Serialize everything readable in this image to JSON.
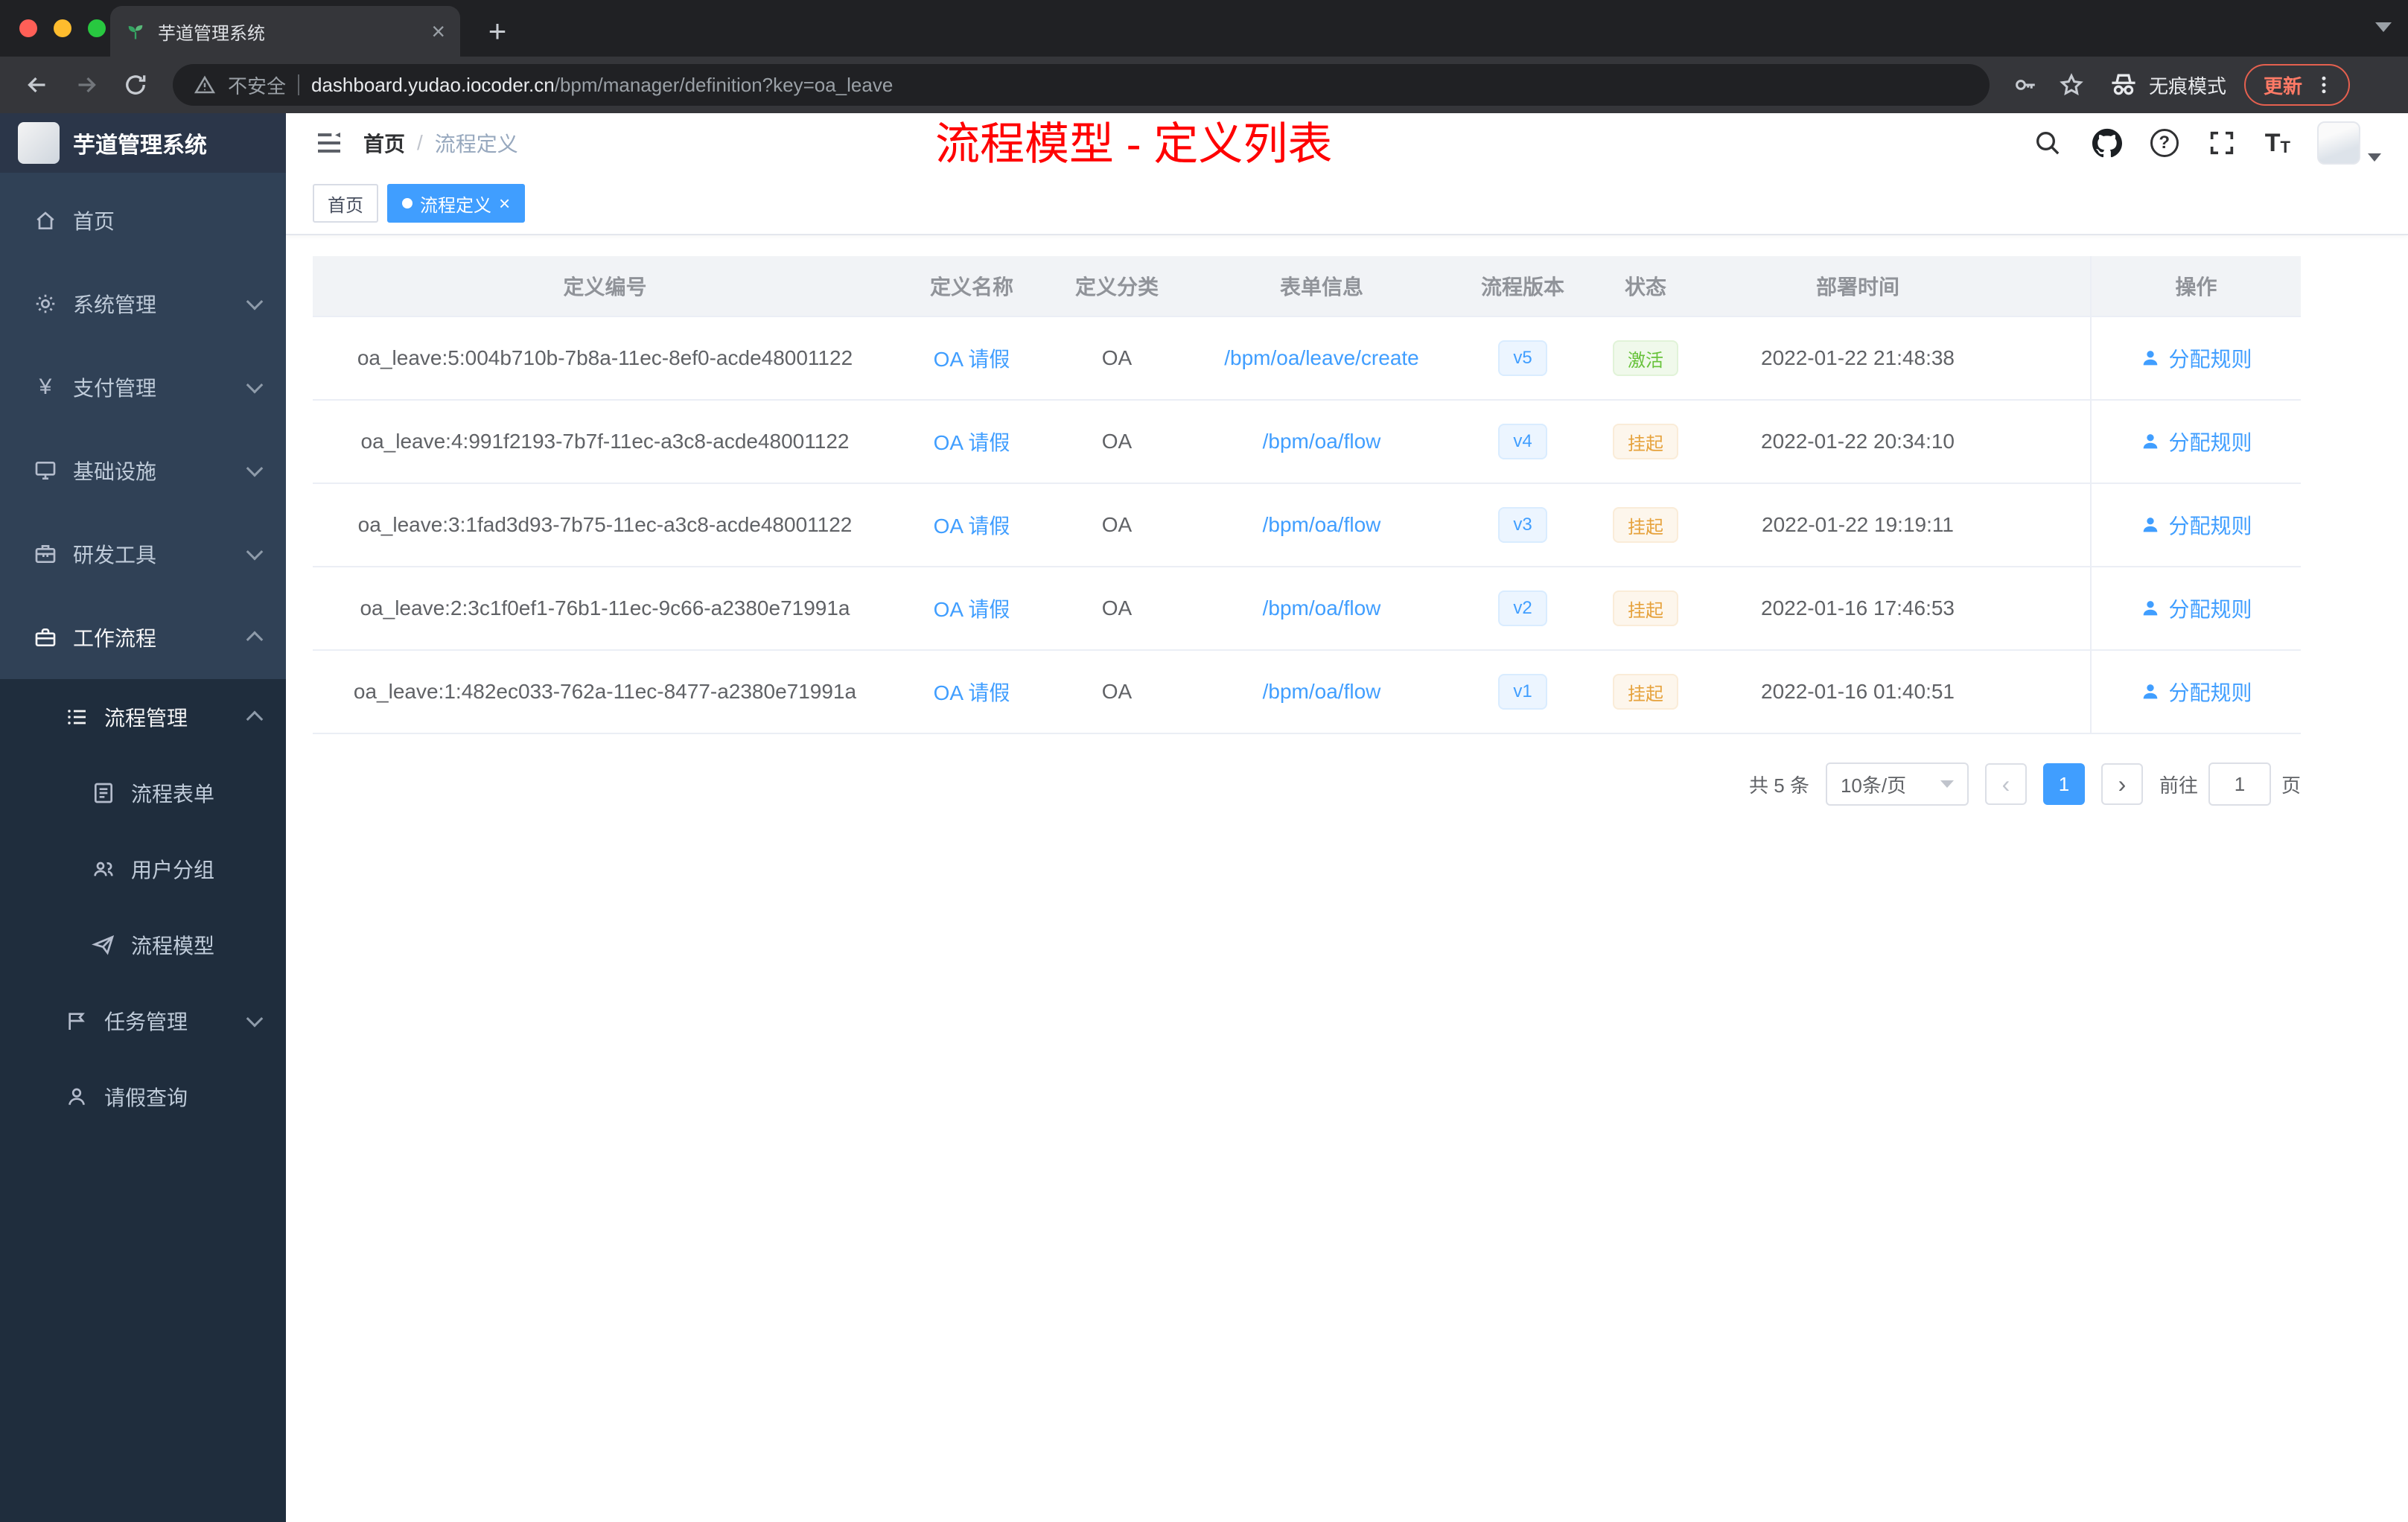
{
  "colors": {
    "accent": "#409eff",
    "success": "#67c23a",
    "warning": "#e6a23c",
    "annotation_red": "#ff0000",
    "sidebar_bg": "#304156",
    "submenu_bg": "#1f2d3d"
  },
  "glyphs": {
    "close": "×",
    "plus": "+",
    "yen": "¥",
    "question": "?",
    "font_big": "T",
    "font_small": "T"
  },
  "icons": {
    "tab_favicon": "plant-icon",
    "security": "warning-triangle-icon",
    "toolbar_right": [
      "key-icon",
      "star-icon",
      "incognito-icon"
    ],
    "header_right": [
      "search-icon",
      "github-icon",
      "question-icon",
      "fullscreen-icon",
      "font-size-icon"
    ]
  },
  "browser": {
    "tab_title": "芋道管理系统",
    "security_label": "不安全",
    "url_domain": "dashboard.yudao.iocoder.cn",
    "url_path": "/bpm/manager/definition?key=oa_leave",
    "incognito_label": "无痕模式",
    "update_label": "更新"
  },
  "sidebar": {
    "brand": "芋道管理系统",
    "items": [
      {
        "label": "首页",
        "icon": "home-icon"
      },
      {
        "label": "系统管理",
        "icon": "gear-icon",
        "chevron": "down"
      },
      {
        "label": "支付管理",
        "icon": "yen-icon",
        "chevron": "down"
      },
      {
        "label": "基础设施",
        "icon": "monitor-icon",
        "chevron": "down"
      },
      {
        "label": "研发工具",
        "icon": "toolbox-icon",
        "chevron": "down"
      },
      {
        "label": "工作流程",
        "icon": "briefcase-icon",
        "chevron": "up",
        "active": true
      },
      {
        "label": "流程管理",
        "icon": "list-icon",
        "chevron": "up",
        "level": 1
      },
      {
        "label": "流程表单",
        "icon": "form-icon",
        "level": 2
      },
      {
        "label": "用户分组",
        "icon": "users-icon",
        "level": 2
      },
      {
        "label": "流程模型",
        "icon": "send-icon",
        "level": 2
      },
      {
        "label": "任务管理",
        "icon": "flag-icon",
        "chevron": "down",
        "level": 1
      },
      {
        "label": "请假查询",
        "icon": "user-icon",
        "level": 1
      }
    ]
  },
  "header": {
    "breadcrumb_home": "首页",
    "breadcrumb_separator": "/",
    "breadcrumb_current": "流程定义",
    "annotation": "流程模型 - 定义列表"
  },
  "tags": [
    {
      "label": "首页",
      "active": false
    },
    {
      "label": "流程定义",
      "active": true
    }
  ],
  "table": {
    "columns": [
      "定义编号",
      "定义名称",
      "定义分类",
      "表单信息",
      "流程版本",
      "状态",
      "部署时间",
      "操作"
    ],
    "rows": [
      {
        "id": "oa_leave:5:004b710b-7b8a-11ec-8ef0-acde48001122",
        "name": "OA 请假",
        "category": "OA",
        "form": "/bpm/oa/leave/create",
        "version": "v5",
        "status": "激活",
        "status_type": "success",
        "time": "2022-01-22 21:48:38",
        "action": "分配规则"
      },
      {
        "id": "oa_leave:4:991f2193-7b7f-11ec-a3c8-acde48001122",
        "name": "OA 请假",
        "category": "OA",
        "form": "/bpm/oa/flow",
        "version": "v4",
        "status": "挂起",
        "status_type": "warning",
        "time": "2022-01-22 20:34:10",
        "action": "分配规则"
      },
      {
        "id": "oa_leave:3:1fad3d93-7b75-11ec-a3c8-acde48001122",
        "name": "OA 请假",
        "category": "OA",
        "form": "/bpm/oa/flow",
        "version": "v3",
        "status": "挂起",
        "status_type": "warning",
        "time": "2022-01-22 19:19:11",
        "action": "分配规则"
      },
      {
        "id": "oa_leave:2:3c1f0ef1-76b1-11ec-9c66-a2380e71991a",
        "name": "OA 请假",
        "category": "OA",
        "form": "/bpm/oa/flow",
        "version": "v2",
        "status": "挂起",
        "status_type": "warning",
        "time": "2022-01-16 17:46:53",
        "action": "分配规则"
      },
      {
        "id": "oa_leave:1:482ec033-762a-11ec-8477-a2380e71991a",
        "name": "OA 请假",
        "category": "OA",
        "form": "/bpm/oa/flow",
        "version": "v1",
        "status": "挂起",
        "status_type": "warning",
        "time": "2022-01-16 01:40:51",
        "action": "分配规则"
      }
    ]
  },
  "pagination": {
    "total_label": "共 5 条",
    "page_size_label": "10条/页",
    "prev": "‹",
    "page": "1",
    "next": "›",
    "goto_label": "前往",
    "goto_value": "1",
    "page_unit": "页"
  }
}
